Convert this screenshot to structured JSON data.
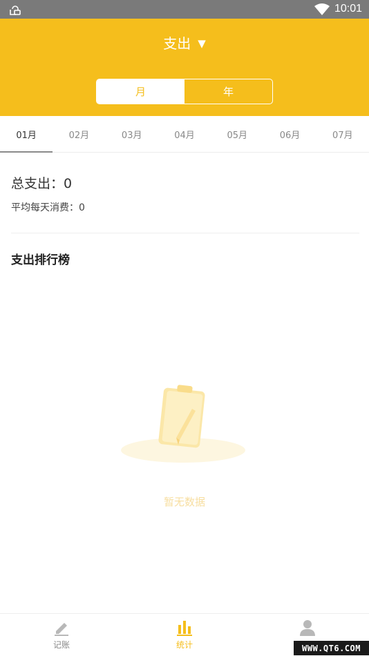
{
  "status_bar": {
    "time": "10:01",
    "icons": [
      "app-notification-icon",
      "wifi-icon"
    ]
  },
  "header": {
    "type_label": "支出",
    "caret": "▼",
    "segments": [
      {
        "label": "月",
        "selected": true
      },
      {
        "label": "年",
        "selected": false
      }
    ]
  },
  "month_tabs": [
    {
      "label": "01月",
      "selected": true
    },
    {
      "label": "02月",
      "selected": false
    },
    {
      "label": "03月",
      "selected": false
    },
    {
      "label": "04月",
      "selected": false
    },
    {
      "label": "05月",
      "selected": false
    },
    {
      "label": "06月",
      "selected": false
    },
    {
      "label": "07月",
      "selected": false
    }
  ],
  "summary": {
    "total_label": "总支出：",
    "total_value": "0",
    "avg_label": "平均每天消费：",
    "avg_value": "0"
  },
  "ranking": {
    "title": "支出排行榜",
    "empty_text": "暂无数据"
  },
  "bottom_nav": [
    {
      "label": "记账",
      "icon": "pencil-icon",
      "active": false
    },
    {
      "label": "统计",
      "icon": "bar-chart-icon",
      "active": true
    },
    {
      "label": "",
      "icon": "user-icon",
      "active": false
    }
  ],
  "colors": {
    "accent": "#f5be1c",
    "status_bar": "#7a7a7a"
  },
  "watermark": "WWW.QT6.COM"
}
